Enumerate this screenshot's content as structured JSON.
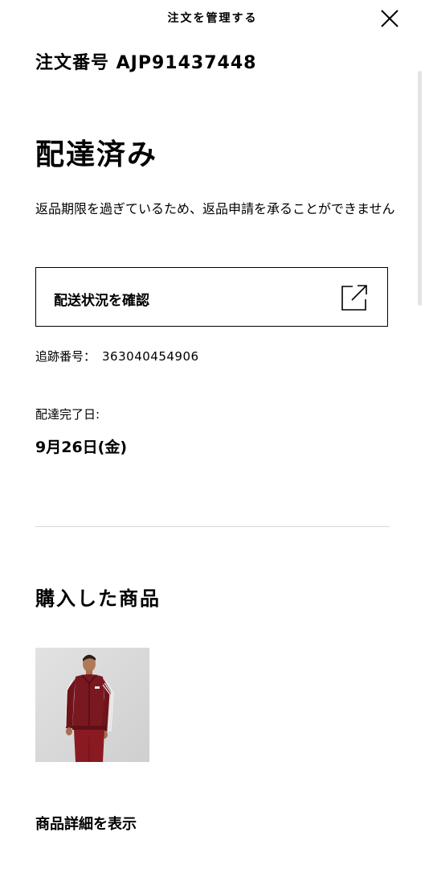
{
  "header": {
    "title": "注文を管理する",
    "close_icon": "close-icon"
  },
  "order": {
    "number_text": "注文番号 AJP91437448"
  },
  "status": {
    "title": "配達済み",
    "return_note": "返品期限を過ぎているため、返品申請を承ることができません"
  },
  "tracking": {
    "button_label": "配送状況を確認",
    "button_icon": "external-link-icon",
    "number_label": "追跡番号：",
    "number_value": "363040454906"
  },
  "delivery": {
    "label": "配達完了日:",
    "date": "9月26日(金)"
  },
  "purchased": {
    "title": "購入した商品",
    "product_image": "product-photo-burgundy-track-jacket",
    "details_link": "商品詳細を表示"
  },
  "colors": {
    "text": "#000000",
    "background": "#ffffff",
    "divider": "#d7d7d7",
    "product_burgundy": "#7a1820"
  }
}
